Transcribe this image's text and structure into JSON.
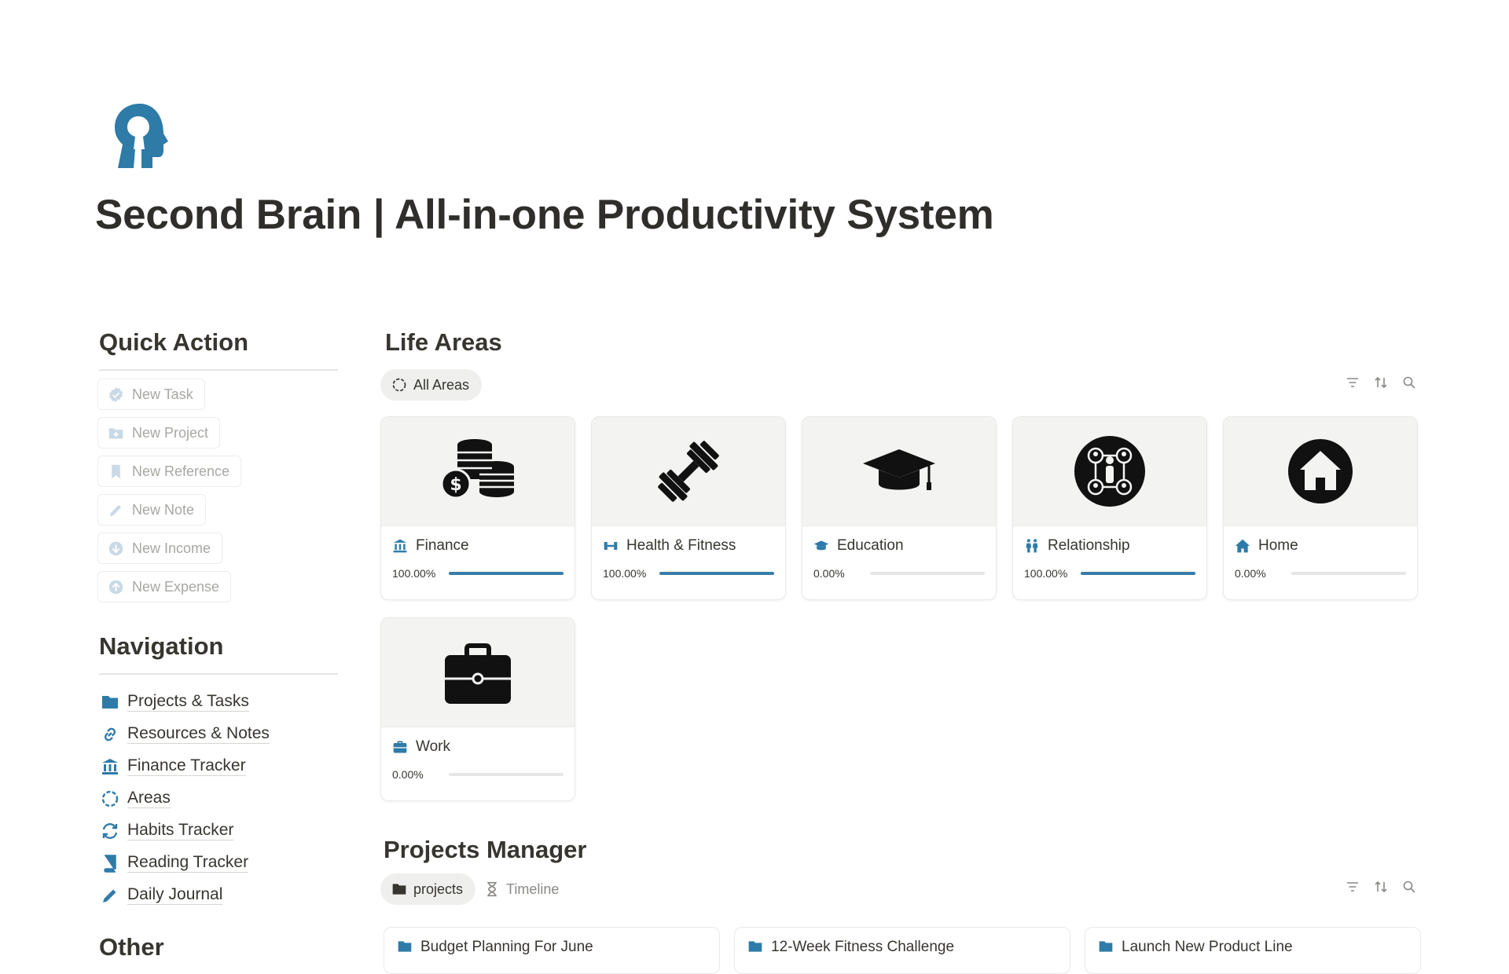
{
  "page": {
    "title": "Second Brain | All-in-one Productivity System",
    "icon": "head-keyhole-icon"
  },
  "colors": {
    "accent": "#2e7ba8",
    "progress": "#3a7ca8",
    "muted_text": "#a8a7a3",
    "text": "#37352f"
  },
  "quick_action": {
    "heading": "Quick Action",
    "buttons": [
      {
        "label": "New Task",
        "icon": "check-badge-icon"
      },
      {
        "label": "New Project",
        "icon": "folder-plus-icon"
      },
      {
        "label": "New Reference",
        "icon": "bookmark-icon"
      },
      {
        "label": "New Note",
        "icon": "pencil-icon"
      },
      {
        "label": "New Income",
        "icon": "arrow-down-circle-icon"
      },
      {
        "label": "New Expense",
        "icon": "arrow-up-circle-icon"
      }
    ]
  },
  "navigation": {
    "heading": "Navigation",
    "items": [
      {
        "label": "Projects & Tasks",
        "icon": "folder-icon"
      },
      {
        "label": "Resources & Notes",
        "icon": "link-icon"
      },
      {
        "label": "Finance Tracker",
        "icon": "bank-icon"
      },
      {
        "label": "Areas",
        "icon": "dashed-circle-icon"
      },
      {
        "label": "Habits Tracker",
        "icon": "repeat-icon"
      },
      {
        "label": "Reading Tracker",
        "icon": "book-icon"
      },
      {
        "label": "Daily Journal",
        "icon": "pencil-icon"
      }
    ]
  },
  "other": {
    "heading": "Other"
  },
  "life_areas": {
    "heading": "Life Areas",
    "view_tab": "All Areas",
    "cards": [
      {
        "title": "Finance",
        "progress_label": "100.00%",
        "progress": 1.0,
        "cover_icon": "coins-icon",
        "title_icon": "bank-icon"
      },
      {
        "title": "Health & Fitness",
        "progress_label": "100.00%",
        "progress": 1.0,
        "cover_icon": "dumbbell-icon",
        "title_icon": "dumbbell-icon"
      },
      {
        "title": "Education",
        "progress_label": "0.00%",
        "progress": 0.0,
        "cover_icon": "graduation-cap-icon",
        "title_icon": "graduation-cap-icon"
      },
      {
        "title": "Relationship",
        "progress_label": "100.00%",
        "progress": 1.0,
        "cover_icon": "people-network-icon",
        "title_icon": "people-icon"
      },
      {
        "title": "Home",
        "progress_label": "0.00%",
        "progress": 0.0,
        "cover_icon": "home-circle-icon",
        "title_icon": "home-icon"
      },
      {
        "title": "Work",
        "progress_label": "0.00%",
        "progress": 0.0,
        "cover_icon": "briefcase-icon",
        "title_icon": "briefcase-icon"
      }
    ]
  },
  "projects_manager": {
    "heading": "Projects Manager",
    "tabs": [
      {
        "label": "projects",
        "icon": "folder-icon",
        "active": true
      },
      {
        "label": "Timeline",
        "icon": "hourglass-icon",
        "active": false
      }
    ],
    "cards": [
      {
        "title": "Budget Planning For June"
      },
      {
        "title": "12-Week Fitness Challenge"
      },
      {
        "title": "Launch New Product Line"
      }
    ]
  }
}
